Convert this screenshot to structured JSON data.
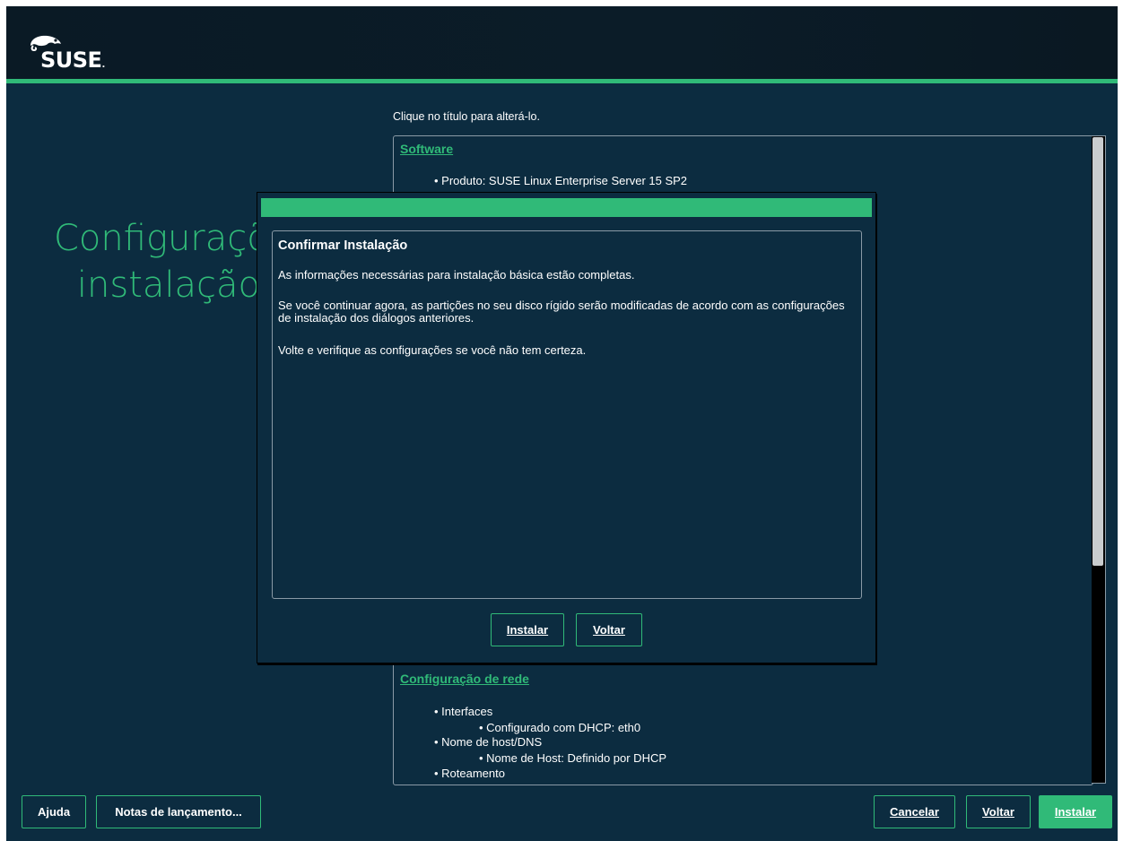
{
  "brand": {
    "logo_text": "SUSE"
  },
  "page": {
    "title_line1": "Configurações de",
    "title_line2": "instalação",
    "hint": "Clique no título para alterá-lo."
  },
  "summary": {
    "software": {
      "title": "Software",
      "items": [
        "• Produto: SUSE Linux Enterprise Server 15 SP2"
      ]
    },
    "network": {
      "title": "Configuração de rede",
      "items": [
        "• Interfaces",
        "• Configurado com DHCP: eth0",
        "• Nome de host/DNS",
        "• Nome de Host: Definido por DHCP",
        "• Roteamento"
      ]
    }
  },
  "dialog": {
    "title": "Confirmar Instalação",
    "p1": "As informações necessárias para instalação básica estão completas.",
    "p2": "Se você continuar agora, as partições no seu disco rígido serão modificadas de acordo com as configurações de instalação dos diálogos anteriores.",
    "p3": "Volte e verifique as configurações se você não tem certeza.",
    "install_button": "Instalar",
    "back_button": "Voltar"
  },
  "footer": {
    "help_button": "Ajuda",
    "release_notes_button": "Notas de lançamento...",
    "cancel_button": "Cancelar",
    "back_button": "Voltar",
    "install_button": "Instalar"
  },
  "colors": {
    "accent": "#30ba78",
    "background": "#0c2c40",
    "topbar": "#0a1a25"
  }
}
